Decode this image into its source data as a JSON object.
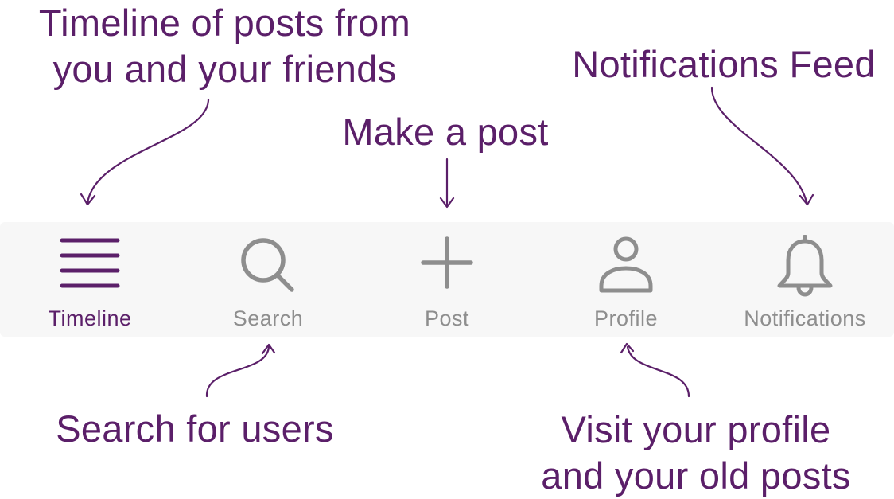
{
  "annotations": {
    "timeline": "Timeline of posts from\nyou and your friends",
    "notifications": "Notifications Feed",
    "post": "Make a post",
    "search": "Search for users",
    "profile": "Visit your profile\nand your old posts"
  },
  "tabbar": {
    "active_tab": "Timeline",
    "tabs": [
      {
        "label": "Timeline",
        "icon": "hamburger-menu-icon"
      },
      {
        "label": "Search",
        "icon": "search-icon"
      },
      {
        "label": "Post",
        "icon": "plus-icon"
      },
      {
        "label": "Profile",
        "icon": "person-icon"
      },
      {
        "label": "Notifications",
        "icon": "bell-icon"
      }
    ]
  },
  "colors": {
    "accent": "#5b1f69",
    "inactive": "#8e8e8e",
    "tabbar_background": "#f7f7f7"
  }
}
